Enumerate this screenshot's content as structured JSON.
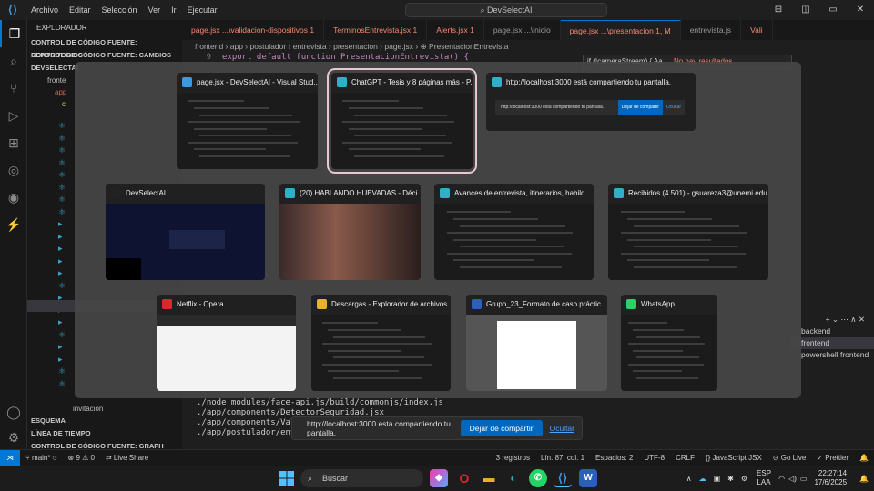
{
  "titlebar": {
    "menus": [
      "Archivo",
      "Editar",
      "Selección",
      "Ver",
      "Ir",
      "Ejecutar"
    ],
    "command_center": "DevSelectAI",
    "window_controls": [
      "⊟",
      "◫",
      "▭",
      "✕"
    ]
  },
  "sidebar": {
    "header": "EXPLORADOR",
    "sections": {
      "repos": "CONTROL DE CÓDIGO FUENTE: REPOSITORIOS",
      "changes": "CONTROL DE CÓDIGO FUENTE: CAMBIOS",
      "project": "DEVSELECTAI",
      "outline": "ESQUEMA",
      "timeline": "LÍNEA DE TIEMPO",
      "graph": "CONTROL DE CÓDIGO FUENTE: GRAPH"
    },
    "items": [
      "fronte",
      "app",
      "c",
      "invitacion"
    ]
  },
  "editor": {
    "tabs": [
      {
        "label": "page.jsx ...\\validacion-dispositivos 1",
        "state": "err"
      },
      {
        "label": "TerminosEntrevista.jsx 1",
        "state": "err"
      },
      {
        "label": "Alerts.jsx 1",
        "state": "err"
      },
      {
        "label": "page.jsx ...\\inicio",
        "state": "normal"
      },
      {
        "label": "page.jsx ...\\presentacion 1, M",
        "state": "active"
      },
      {
        "label": "entrevista.js",
        "state": "normal"
      },
      {
        "label": "Vali",
        "state": "err"
      }
    ],
    "breadcrumb": "frontend  ›  app  ›  postulador  ›  entrevista  ›  presentacion  ›  page.jsx  ›  ⊕ PresentacionEntrevista",
    "line_number": "9",
    "code_line": "export default function PresentacionEntrevista() {",
    "find": {
      "query": "if (!cameraStream) { Aa",
      "result": "No hay resultados"
    }
  },
  "terminal": {
    "lines": [
      "./node_modules/face-api.js/build/commonjs/index.js",
      "./app/components/DetectorSeguridad.jsx",
      "./app/components/Valida",
      "./app/postulador/entrev"
    ],
    "panel": [
      "backend",
      "frontend",
      "powershell frontend"
    ]
  },
  "sharebar": {
    "message": "http://localhost:3000 está compartiendo tu pantalla.",
    "stop_label": "Dejar de compartir",
    "hide_label": "Ocultar"
  },
  "statusbar": {
    "branch": "main*",
    "errors": "⊗ 9 ⚠ 0",
    "live": "Live Share",
    "registros": "3 registros",
    "position": "Lín. 87, col. 1",
    "spaces": "Espacios: 2",
    "encoding": "UTF-8",
    "eol": "CRLF",
    "language": "JavaScript JSX",
    "golive": "Go Live",
    "prettier": "Prettier"
  },
  "taskbar": {
    "search_placeholder": "Buscar",
    "lang": "ESP",
    "lang2": "LAA",
    "time": "22:27:14",
    "date": "17/6/2025"
  },
  "alt_tab": {
    "windows": [
      {
        "title": "page.jsx - DevSelectAI - Visual Stud...",
        "icon": "vscode-icon",
        "color": "#3b9ae0",
        "thumb": "dark"
      },
      {
        "title": "ChatGPT - Tesis y 8 páginas más - P...",
        "icon": "edge-icon",
        "color": "#2fb0c9",
        "thumb": "dark",
        "selected": true
      },
      {
        "title": "http://localhost:3000 está compartiendo tu pantalla.",
        "icon": "edge-icon",
        "color": "#2fb0c9",
        "thumb": "share",
        "share_text": "http://localhost:3000 está compartiendo tu pantalla.",
        "share_btn": "Dejar de compartir",
        "share_hide": "Ocultar"
      },
      {
        "title": "DevSelectAI",
        "icon": "devselect-icon",
        "color": "#222222",
        "thumb": "navy"
      },
      {
        "title": "(20) HABLANDO HUEVADAS - Déci...",
        "icon": "edge-icon",
        "color": "#2fb0c9",
        "thumb": "video"
      },
      {
        "title": "Avances de entrevista, itinerarios, habild...",
        "icon": "edge-icon",
        "color": "#2fb0c9",
        "thumb": "dark"
      },
      {
        "title": "Recibidos (4.501) - gsuareza3@unemi.edu...",
        "icon": "edge-icon",
        "color": "#2fb0c9",
        "thumb": "dark"
      },
      {
        "title": "Netflix - Opera",
        "icon": "opera-icon",
        "color": "#e0262c",
        "thumb": "white"
      },
      {
        "title": "Descargas - Explorador de archivos",
        "icon": "folder-icon",
        "color": "#e8b22e",
        "thumb": "dark"
      },
      {
        "title": "Grupo_23_Formato de caso práctic...",
        "icon": "word-icon",
        "color": "#2b5fb8",
        "thumb": "doc"
      },
      {
        "title": "WhatsApp",
        "icon": "whatsapp-icon",
        "color": "#25d366",
        "thumb": "dark"
      }
    ]
  }
}
